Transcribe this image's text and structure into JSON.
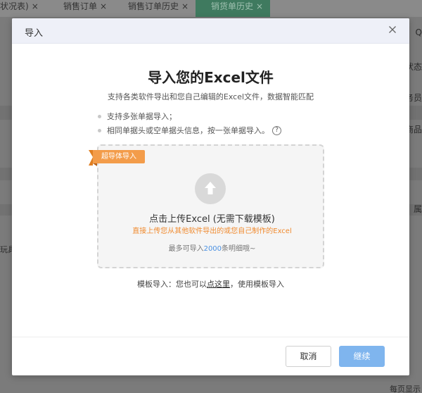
{
  "background": {
    "tabs": [
      {
        "label": "状况表)"
      },
      {
        "label": "销售订单"
      },
      {
        "label": "销售订单历史"
      },
      {
        "label": "销货单历史"
      }
    ],
    "close_glyph": "×",
    "right_edge_texts": [
      "Q",
      "状态",
      "务员",
      "商品",
      "属"
    ],
    "left_edge_text": "玩具",
    "bottom_text": "每页显示"
  },
  "modal": {
    "title": "导入",
    "close_icon": "close-icon",
    "headline": "导入您的Excel文件",
    "subline": "支持各类软件导出和您自己编辑的Excel文件，数据智能匹配",
    "bullets": [
      "支持多张单据导入；",
      "相同单据头或空单据头信息，按一张单据导入。"
    ],
    "help_glyph": "?",
    "ribbon_label": "超导体导入",
    "upload_icon": "upload-arrow-icon",
    "upload_title": "点击上传Excel (无需下载模板)",
    "upload_hint": "直接上传您从其他软件导出的或您自己制作的Excel",
    "limit_prefix": "最多可导入",
    "limit_number": "2000",
    "limit_suffix": "条明细哦~",
    "template_prefix": "模板导入：您也可以",
    "template_link": "点这里",
    "template_suffix": "，使用模板导入",
    "cancel_label": "取消",
    "continue_label": "继续",
    "colors": {
      "accent_orange": "#f39c4a",
      "primary_blue": "#7fb5ee",
      "link_blue": "#4a90e2"
    }
  }
}
